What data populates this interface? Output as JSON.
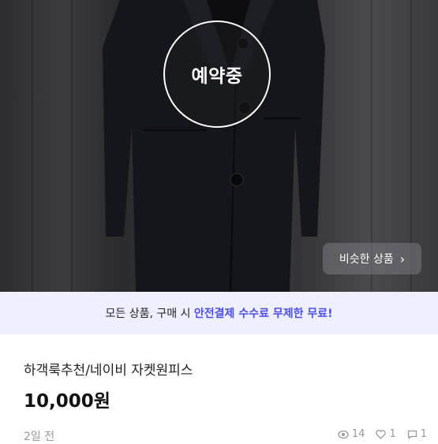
{
  "overlay": {
    "reserved_label": "예약중"
  },
  "similar_button": {
    "label": "비슷한 상품"
  },
  "promo": {
    "text_before": "모든 상품, 구매 시 ",
    "highlight": "안전결제 수수료 무제한 무료!"
  },
  "product": {
    "title": "하객룩추천/네이비 자켓원피스",
    "price": "10,000원",
    "posted": "2일 전",
    "stats": {
      "views": "14",
      "likes": "1",
      "chats": "1"
    }
  },
  "colors": {
    "accent": "#4d4ee6",
    "promo_bg": "#eef0ff",
    "dress": "#15161c"
  },
  "icons": {
    "similar": "chevron-right-icon",
    "views": "eye-icon",
    "likes": "heart-icon",
    "chats": "chat-icon"
  }
}
